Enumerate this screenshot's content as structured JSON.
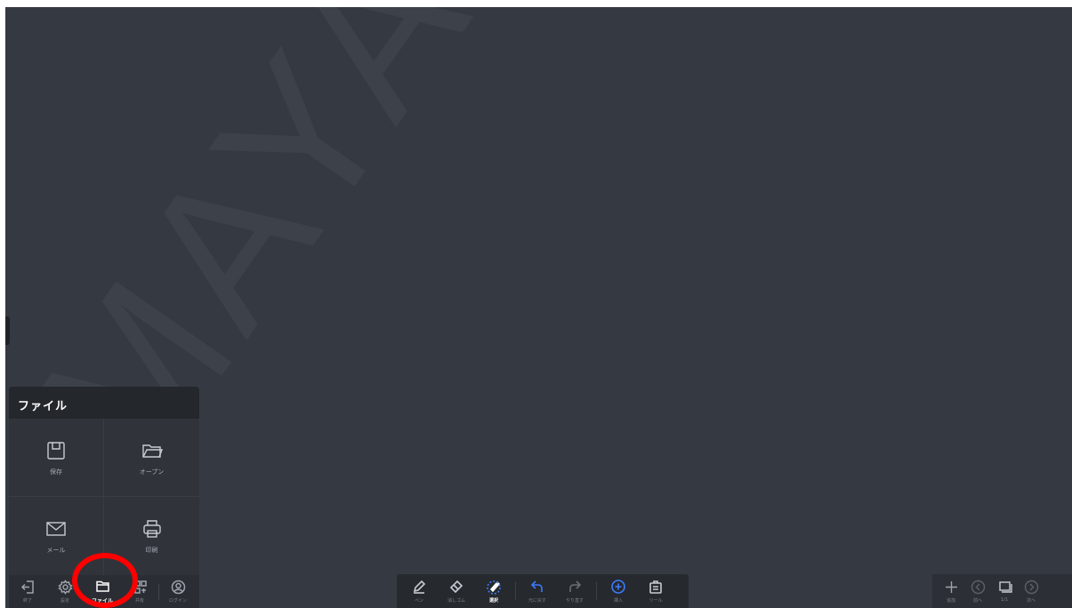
{
  "watermark": "MAYA S",
  "file_panel": {
    "title": "ファイル",
    "items": [
      {
        "label": "保存",
        "icon": "save-icon"
      },
      {
        "label": "オープン",
        "icon": "folder-open-icon"
      },
      {
        "label": "メール",
        "icon": "mail-icon"
      },
      {
        "label": "印刷",
        "icon": "print-icon"
      }
    ]
  },
  "left_toolbar": {
    "items": [
      {
        "label": "終了",
        "icon": "exit-icon"
      },
      {
        "label": "設定",
        "icon": "gear-icon"
      },
      {
        "label": "ファイル",
        "icon": "folder-icon",
        "active": true
      },
      {
        "label": "共有",
        "icon": "share-icon"
      },
      {
        "label": "ログイン",
        "icon": "user-icon"
      }
    ]
  },
  "center_toolbar": {
    "items": [
      {
        "label": "ペン",
        "icon": "pen-icon"
      },
      {
        "label": "消しゴム",
        "icon": "eraser-icon"
      },
      {
        "label": "選択",
        "icon": "select-icon",
        "active": true
      },
      {
        "label": "元に戻す",
        "icon": "undo-icon"
      },
      {
        "label": "やり直す",
        "icon": "redo-icon"
      },
      {
        "label": "挿入",
        "icon": "insert-icon"
      },
      {
        "label": "ツール",
        "icon": "toolbox-icon"
      }
    ]
  },
  "right_toolbar": {
    "items": [
      {
        "label": "追加",
        "icon": "add-page-icon"
      },
      {
        "label": "前へ",
        "icon": "prev-page-icon"
      },
      {
        "label": "1/1",
        "icon": "pages-icon"
      },
      {
        "label": "次へ",
        "icon": "next-page-icon"
      }
    ]
  },
  "colors": {
    "canvas": "#353941",
    "accent_blue": "#3d7bff",
    "highlight": "#ff0000"
  }
}
